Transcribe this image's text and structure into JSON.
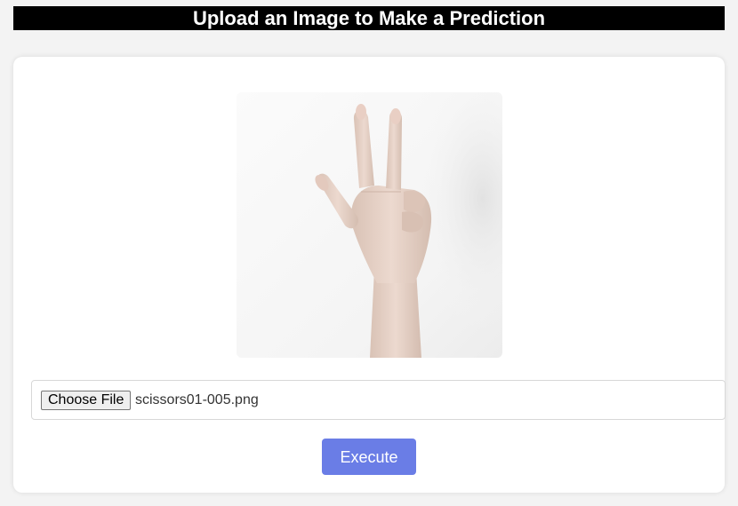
{
  "header": {
    "title": "Upload an Image to Make a Prediction"
  },
  "upload": {
    "preview_image": "hand-scissors-gesture-photo",
    "choose_file_label": "Choose File",
    "selected_file_name": "scissors01-005.png"
  },
  "actions": {
    "execute_label": "Execute"
  },
  "colors": {
    "title_bg": "#000000",
    "title_text": "#ffffff",
    "execute_bg": "#6a7de6",
    "card_bg": "#ffffff",
    "page_bg": "#f3f3f3"
  }
}
